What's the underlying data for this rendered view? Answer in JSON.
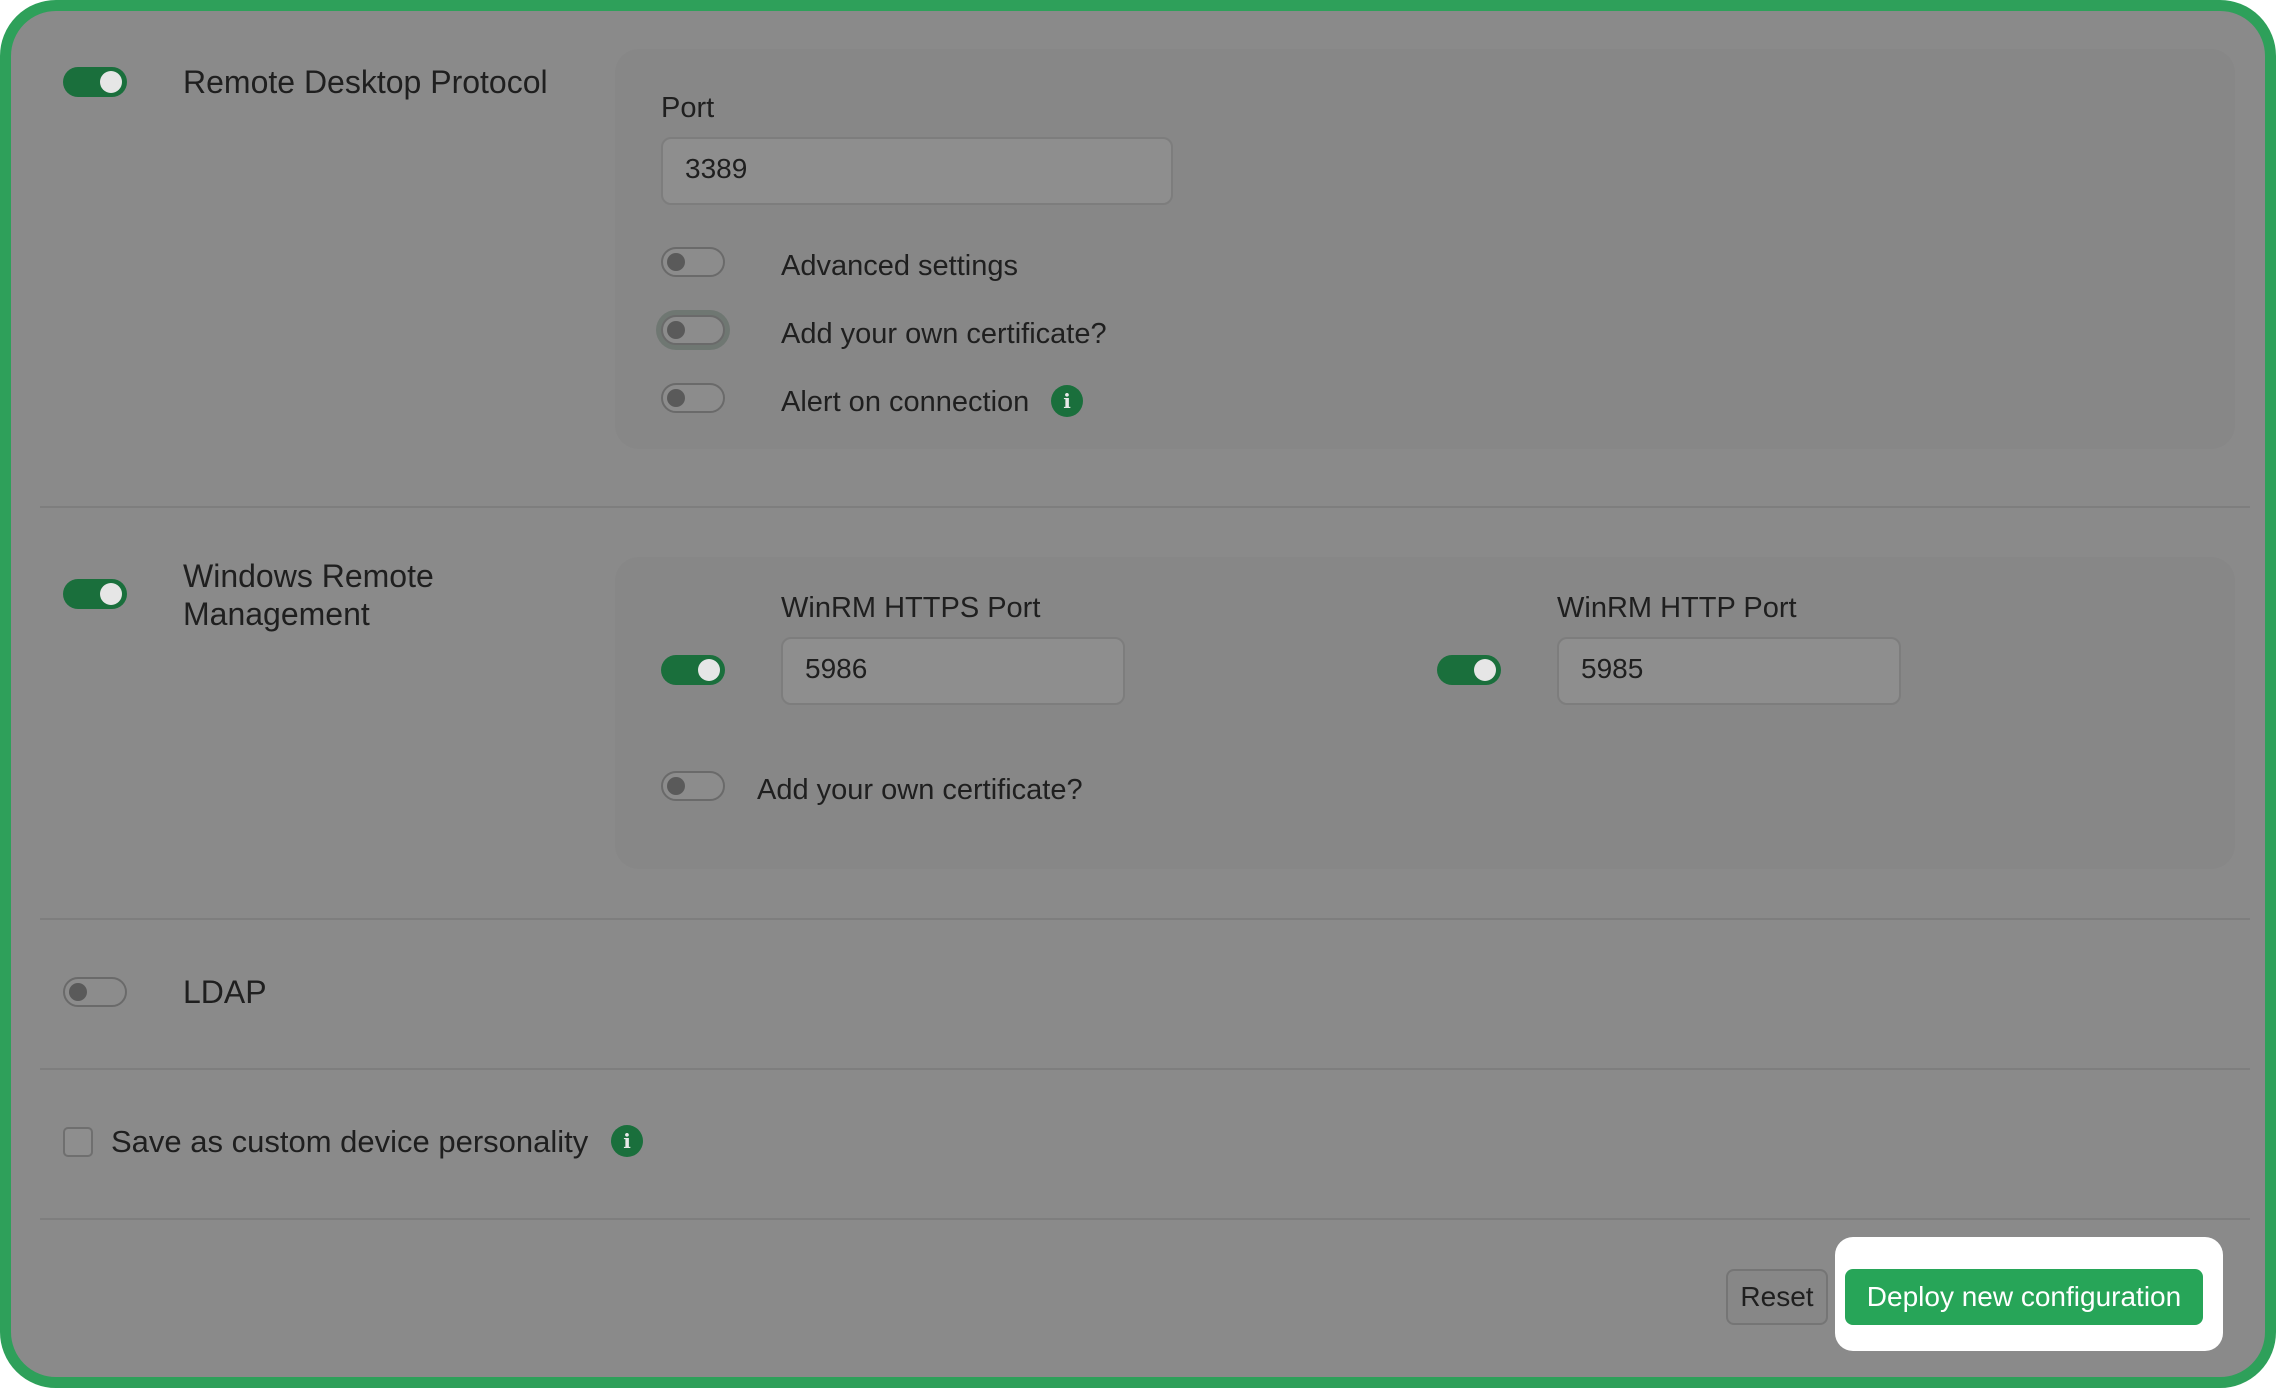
{
  "rdp": {
    "title": "Remote Desktop Protocol",
    "enabled": true,
    "port_label": "Port",
    "port_value": "3389",
    "advanced_settings_label": "Advanced settings",
    "own_certificate_label": "Add your own certificate?",
    "alert_label": "Alert on connection"
  },
  "winrm": {
    "title_line1": "Windows Remote",
    "title_line2": "Management",
    "enabled": true,
    "https_label": "WinRM HTTPS Port",
    "https_value": "5986",
    "http_label": "WinRM HTTP Port",
    "http_value": "5985",
    "own_certificate_label": "Add your own certificate?"
  },
  "ldap": {
    "title": "LDAP",
    "enabled": false
  },
  "save_personality_label": "Save as custom device personality",
  "info_icon_glyph": "i",
  "buttons": {
    "reset_label": "Reset",
    "deploy_label": "Deploy new configuration"
  },
  "colors": {
    "accent": "#27a558",
    "toggle_on": "#1a6f3c",
    "frame_border": "#2ea05a",
    "overlay": "#8a8a8a"
  }
}
